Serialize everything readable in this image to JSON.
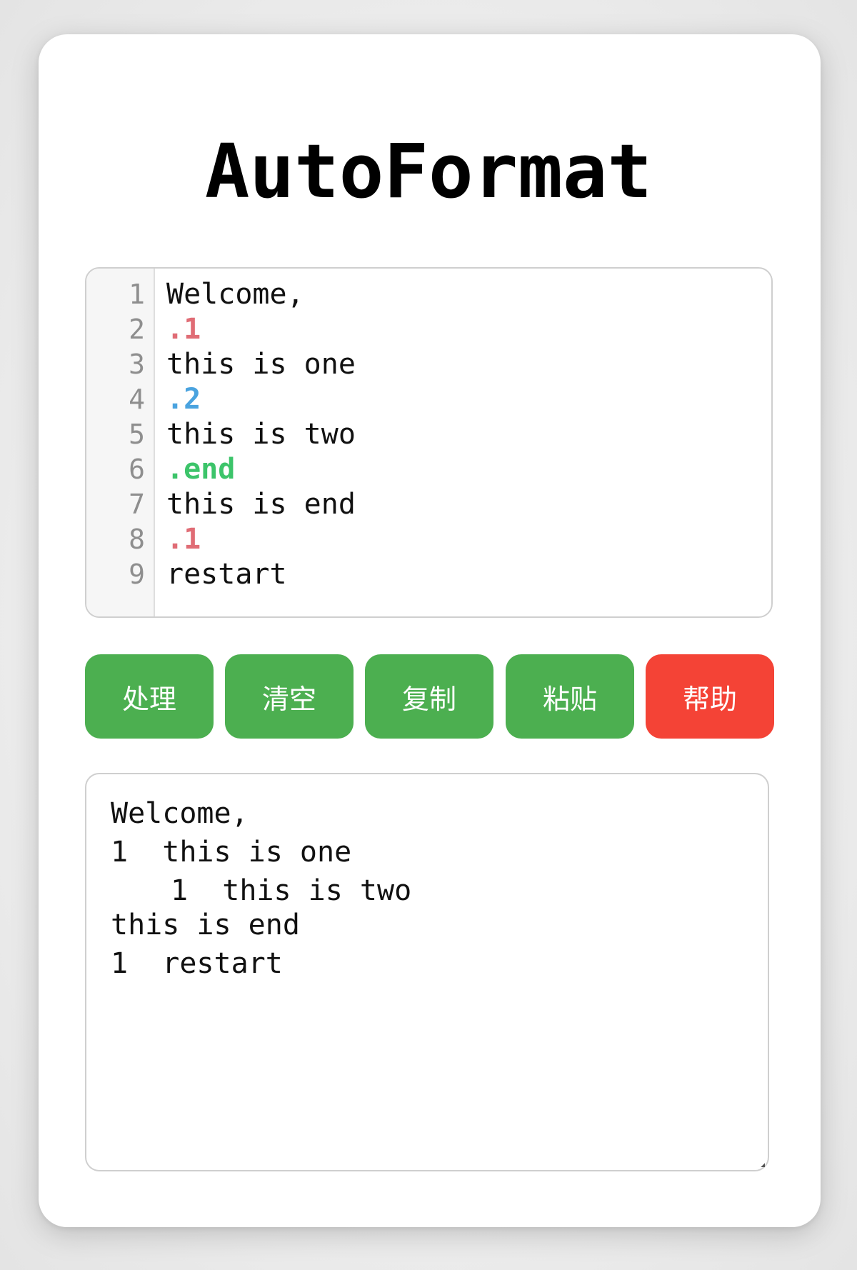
{
  "app": {
    "title": "AutoFormat"
  },
  "colors": {
    "marker_1": "#e06c75",
    "marker_2": "#4aa3df",
    "marker_end": "#3cc46a",
    "button_green": "#4caf50",
    "button_red": "#f44336"
  },
  "editor": {
    "line_numbers": [
      "1",
      "2",
      "3",
      "4",
      "5",
      "6",
      "7",
      "8",
      "9"
    ],
    "lines": [
      {
        "text": "Welcome,",
        "kind": "text"
      },
      {
        "text": ".1",
        "kind": "marker_1"
      },
      {
        "text": "this is one",
        "kind": "text"
      },
      {
        "text": ".2",
        "kind": "marker_2"
      },
      {
        "text": "this is two",
        "kind": "text"
      },
      {
        "text": ".end",
        "kind": "marker_end"
      },
      {
        "text": "this is end",
        "kind": "text"
      },
      {
        "text": ".1",
        "kind": "marker_1"
      },
      {
        "text": "restart",
        "kind": "text"
      }
    ]
  },
  "toolbar": {
    "process_label": "处理",
    "clear_label": "清空",
    "copy_label": "复制",
    "paste_label": "粘贴",
    "help_label": "帮助"
  },
  "output": {
    "lines": [
      "Welcome,",
      "1  this is one",
      "1  this is two",
      "this is end",
      "1  restart"
    ]
  }
}
